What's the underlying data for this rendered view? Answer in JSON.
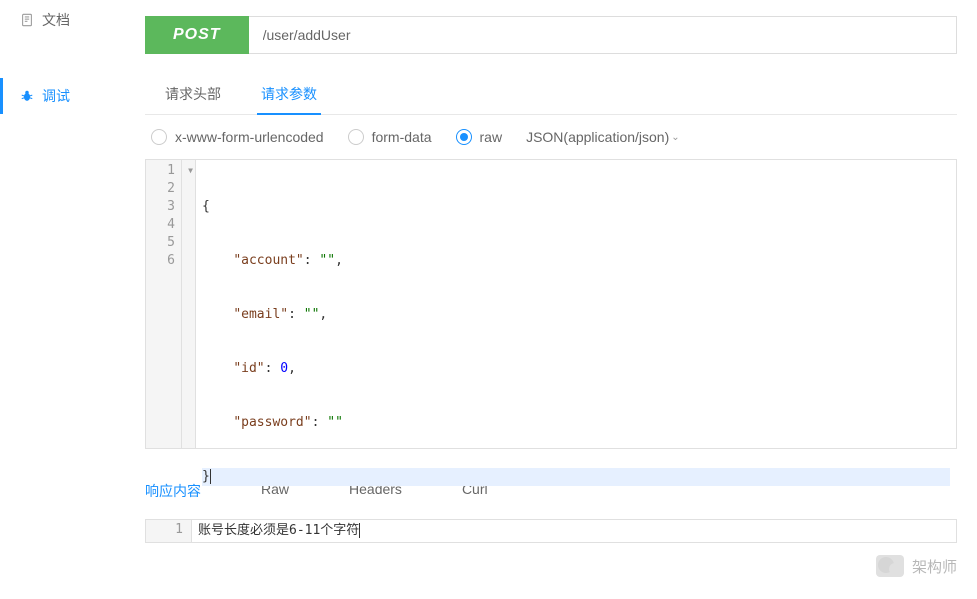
{
  "sidebar": {
    "items": [
      {
        "label": "文档",
        "icon": "document-icon"
      },
      {
        "label": "调试",
        "icon": "bug-icon"
      }
    ]
  },
  "request": {
    "method": "POST",
    "url": "/user/addUser"
  },
  "tabs": {
    "headers": "请求头部",
    "params": "请求参数"
  },
  "bodyTypes": {
    "urlencoded": "x-www-form-urlencoded",
    "formdata": "form-data",
    "raw": "raw",
    "contentType": "JSON(application/json)"
  },
  "editor": {
    "lines": [
      "1",
      "2",
      "3",
      "4",
      "5",
      "6"
    ],
    "code": {
      "l1": "{",
      "l2_key": "\"account\"",
      "l2_val": "\"\"",
      "l3_key": "\"email\"",
      "l3_val": "\"\"",
      "l4_key": "\"id\"",
      "l4_val": "0",
      "l5_key": "\"password\"",
      "l5_val": "\"\"",
      "l6": "}"
    }
  },
  "responseTabs": {
    "content": "响应内容",
    "raw": "Raw",
    "headers": "Headers",
    "curl": "Curl"
  },
  "response": {
    "line": "1",
    "text": "账号长度必须是6-11个字符"
  },
  "watermark": {
    "text": "架构师"
  }
}
